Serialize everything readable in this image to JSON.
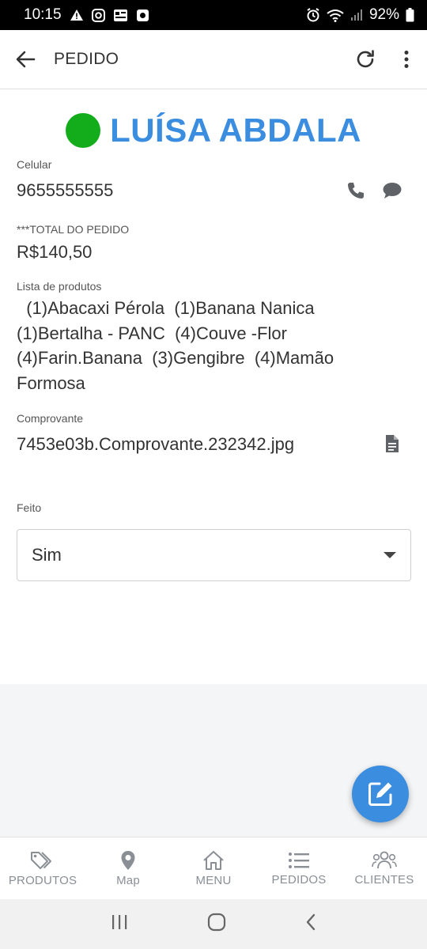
{
  "status_bar": {
    "time": "10:15",
    "battery": "92%"
  },
  "header": {
    "title": "PEDIDO"
  },
  "customer": {
    "name": "LUÍSA ABDALA",
    "status_color": "#13ad1b",
    "name_color": "#3b8de0"
  },
  "fields": {
    "phone_label": "Celular",
    "phone_value": "9655555555",
    "total_label": "***TOTAL DO PEDIDO",
    "total_value": "R$140,50",
    "products_label": "Lista de produtos",
    "products_value": "  (1)Abacaxi Pérola  (1)Banana Nanica  (1)Bertalha - PANC  (4)Couve -Flor  (4)Farin.Banana  (3)Gengibre  (4)Mamão Formosa",
    "receipt_label": "Comprovante",
    "receipt_value": "7453e03b.Comprovante.232342.jpg",
    "done_label": "Feito",
    "done_value": "Sim"
  },
  "bottom_nav": [
    {
      "label": "PRODUTOS",
      "icon": "tags-icon"
    },
    {
      "label": "Map",
      "icon": "map-pin-icon"
    },
    {
      "label": "MENU",
      "icon": "home-icon"
    },
    {
      "label": "PEDIDOS",
      "icon": "list-icon"
    },
    {
      "label": "CLIENTES",
      "icon": "users-icon"
    }
  ],
  "icons": {
    "back": "arrow-left-icon",
    "refresh": "refresh-icon",
    "more": "more-vertical-icon",
    "phone": "phone-icon",
    "message": "chat-icon",
    "file": "file-icon",
    "fab": "edit-icon"
  },
  "colors": {
    "accent": "#3b8de0",
    "online": "#13ad1b"
  }
}
